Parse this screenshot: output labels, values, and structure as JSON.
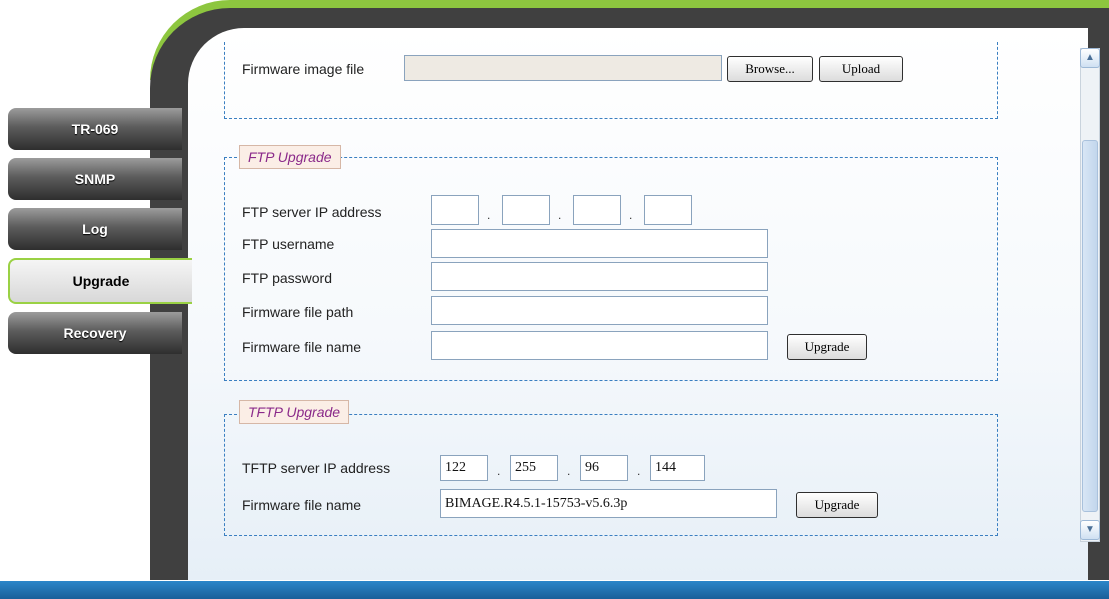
{
  "sidebar": {
    "items": [
      {
        "label": "TR-069"
      },
      {
        "label": "SNMP"
      },
      {
        "label": "Log"
      },
      {
        "label": "Upgrade",
        "active": true
      },
      {
        "label": "Recovery"
      }
    ]
  },
  "http_upgrade": {
    "file_label": "Firmware image file",
    "file_value": "",
    "browse_label": "Browse...",
    "upload_label": "Upload"
  },
  "ftp": {
    "legend": "FTP Upgrade",
    "ip_label": "FTP server IP address",
    "ip_values": [
      "",
      "",
      "",
      ""
    ],
    "username_label": "FTP username",
    "username_value": "",
    "password_label": "FTP password",
    "password_value": "",
    "path_label": "Firmware file path",
    "path_value": "",
    "name_label": "Firmware file name",
    "name_value": "",
    "button_label": "Upgrade"
  },
  "tftp": {
    "legend": "TFTP Upgrade",
    "ip_label": "TFTP server IP address",
    "ip_values": [
      "122",
      "255",
      "96",
      "144"
    ],
    "name_label": "Firmware file name",
    "name_value": "BIMAGE.R4.5.1-15753-v5.6.3p",
    "button_label": "Upgrade"
  },
  "scrollbar": {
    "up_icon": "scroll-up-arrow",
    "down_icon": "scroll-down-arrow"
  },
  "colors": {
    "accent_green": "#8dc63f",
    "frame_dark": "#404040",
    "dashed_border": "#3a7fc1",
    "legend_text": "#8a2a8a",
    "bottom_bar": "#1a5f99"
  }
}
